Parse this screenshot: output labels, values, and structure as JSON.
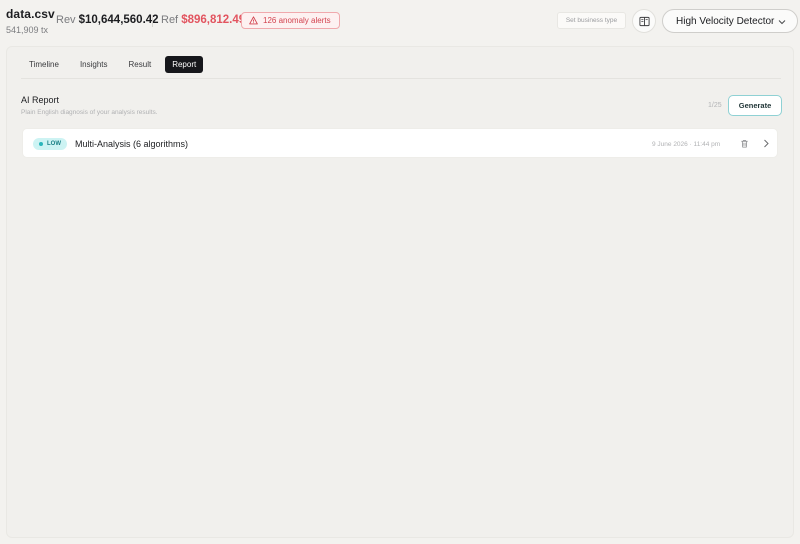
{
  "file": {
    "name": "data.csv",
    "tx_count": "541,909 tx"
  },
  "metrics": {
    "rev_label": "Rev",
    "rev_value": "$10,644,560.42",
    "ref_label": "Ref",
    "ref_value": "$896,812.49"
  },
  "alerts": {
    "label": "126 anomaly alerts",
    "icon": "warning-triangle-icon"
  },
  "business_type": {
    "placeholder": "Set business type"
  },
  "book_button": {
    "icon": "book-icon"
  },
  "detector": {
    "selected": "High Velocity Detector",
    "icon": "chevron-down-icon"
  },
  "tabs": [
    {
      "label": "Timeline",
      "active": false
    },
    {
      "label": "Insights",
      "active": false
    },
    {
      "label": "Result",
      "active": false
    },
    {
      "label": "Report",
      "active": true
    }
  ],
  "report": {
    "title": "AI Report",
    "subtitle": "Plain English diagnosis of your analysis results.",
    "count": "1/25",
    "generate_label": "Generate",
    "items": [
      {
        "severity": "LOW",
        "title": "Multi-Analysis (6 algorithms)",
        "date": "9 June 2026 · 11:44 pm"
      }
    ]
  },
  "colors": {
    "accent": "#2ab6bb",
    "alert": "#d2434f",
    "ref_value": "#e2545f",
    "active_tab": "#16171b"
  }
}
